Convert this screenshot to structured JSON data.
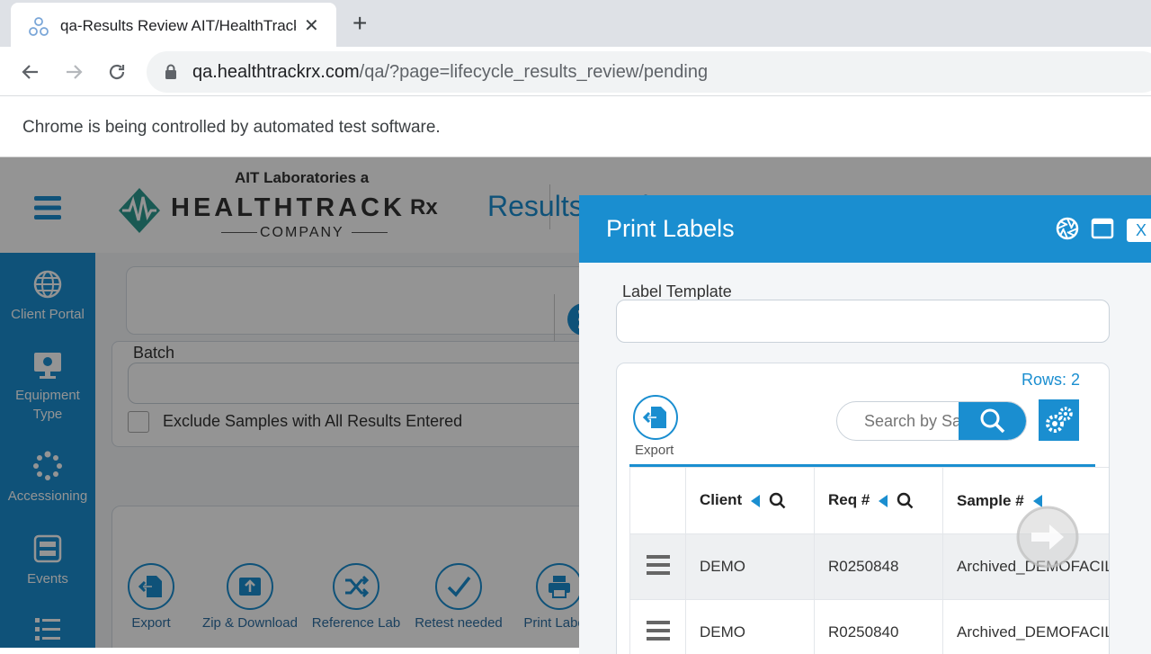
{
  "browser": {
    "tab_title": "qa-Results Review AIT/HealthTrackRx",
    "tab_close": "✕",
    "new_tab": "+",
    "url_host": "qa.healthtrackrx.com",
    "url_path": "/qa/?page=lifecycle_results_review/pending",
    "infobar_text": "Chrome is being controlled by automated test software."
  },
  "app": {
    "page_title": "Results Review",
    "logo": {
      "top_line": "AIT Laboratories a",
      "brand": "HEALTHTRACK",
      "brand_suffix": "Rx",
      "bottom_line": "COMPANY"
    },
    "sidebar": {
      "items": [
        {
          "label": "Client Portal",
          "icon": "globe-icon"
        },
        {
          "label": "Equipment Type",
          "icon": "monitor-icon"
        },
        {
          "label": "Accessioning",
          "icon": "spinner-icon"
        },
        {
          "label": "Events",
          "icon": "server-icon"
        },
        {
          "label": "",
          "icon": "list-icon"
        }
      ]
    },
    "batch": {
      "label": "Batch",
      "value": "",
      "exclude_label": "Exclude Samples with All Results Entered"
    },
    "actions": [
      {
        "label": "Export",
        "icon": "export-icon"
      },
      {
        "label": "Zip & Download",
        "icon": "upload-icon"
      },
      {
        "label": "Reference Lab",
        "icon": "shuffle-icon"
      },
      {
        "label": "Retest needed",
        "icon": "check-icon"
      },
      {
        "label": "Print Labels",
        "icon": "printer-icon"
      }
    ]
  },
  "modal": {
    "title": "Print Labels",
    "close_label": "X",
    "label_template": {
      "label": "Label Template",
      "value": ""
    },
    "rows_count": "Rows: 2",
    "export_label": "Export",
    "search_placeholder": "Search by Sample",
    "columns": [
      "Client",
      "Req #",
      "Sample #"
    ],
    "rows": [
      {
        "client": "DEMO",
        "req": "R0250848",
        "sample": "Archived_DEMOFACILITY"
      },
      {
        "client": "DEMO",
        "req": "R0250840",
        "sample": "Archived_DEMOFACILITY"
      }
    ]
  },
  "colors": {
    "accent": "#1a8ed0",
    "overlay": "rgba(0,0,0,0.42)"
  }
}
